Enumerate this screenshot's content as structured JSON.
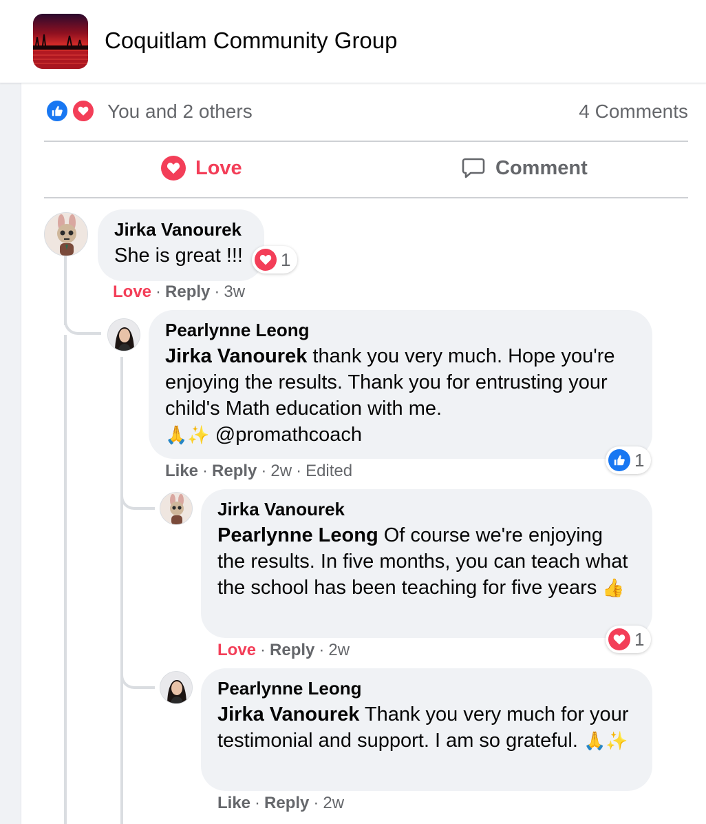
{
  "header": {
    "group_name": "Coquitlam Community Group"
  },
  "summary": {
    "reactions_text": "You and 2 others",
    "comments_count": "4 Comments"
  },
  "actions": {
    "love_label": "Love",
    "comment_label": "Comment"
  },
  "comments": [
    {
      "author": "Jirka Vanourek",
      "text": "She is great !!!",
      "reaction_count": "1",
      "reaction_type": "love-icon",
      "action_primary": "Love",
      "action_reply": "Reply",
      "time": "3w"
    },
    {
      "author": "Pearlynne Leong",
      "mention": "Jirka Vanourek",
      "text": " thank you very much. Hope you're enjoying the results. Thank you for entrusting your child's Math education with me.",
      "emoji": "🙏✨",
      "handle": " @promathcoach",
      "reaction_count": "1",
      "reaction_type": "like-icon",
      "action_primary": "Like",
      "action_reply": "Reply",
      "time": "2w",
      "edited": "Edited"
    },
    {
      "author": "Jirka Vanourek",
      "mention": "Pearlynne Leong",
      "text": " Of course we're enjoying the results. In five months, you can teach what the school has been teaching for five years",
      "emoji": "👍",
      "reaction_count": "1",
      "reaction_type": "love-icon",
      "action_primary": "Love",
      "action_reply": "Reply",
      "time": "2w"
    },
    {
      "author": "Pearlynne Leong",
      "mention": "Jirka Vanourek",
      "text": " Thank you very much for your testimonial and support. I am so grateful.",
      "emoji": "🙏✨",
      "action_primary": "Like",
      "action_reply": "Reply",
      "time": "2w"
    }
  ],
  "colors": {
    "love": "#f33e58",
    "like": "#1877f2",
    "bubble": "#f0f2f5",
    "muted": "#65676b"
  }
}
